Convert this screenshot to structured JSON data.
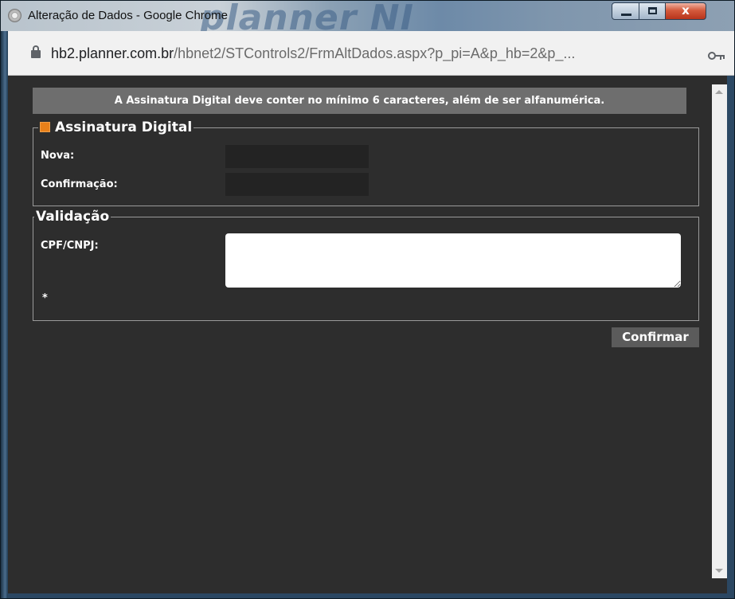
{
  "window": {
    "title": "Alteração de Dados - Google Chrome",
    "watermark": "planner NI",
    "controls": {
      "minimize_icon": "minimize-icon",
      "maximize_icon": "maximize-icon",
      "close_label": "x"
    }
  },
  "addressbar": {
    "url_host": "hb2.planner.com.br",
    "url_path": "/hbnet2/STControls2/FrmAltDados.aspx?p_pi=A&p_hb=2&p_...",
    "lock_icon": "lock-icon",
    "key_icon": "key-icon"
  },
  "notice": {
    "text": "A Assinatura Digital deve conter no mínimo 6 caracteres, além de ser alfanumérica."
  },
  "assinatura": {
    "legend": "Assinatura Digital",
    "nova_label": "Nova:",
    "nova_value": "",
    "confirmacao_label": "Confirmação:",
    "confirmacao_value": ""
  },
  "validacao": {
    "legend": "Validação",
    "cpf_label": "CPF/CNPJ:",
    "cpf_value": "",
    "required_mark": "*"
  },
  "actions": {
    "confirm_label": "Confirmar"
  },
  "colors": {
    "page_bg": "#2d2d2d",
    "notice_bg": "#6e6e6e",
    "legend_icon": "#e8801a",
    "button_bg": "#5b5b5b"
  }
}
